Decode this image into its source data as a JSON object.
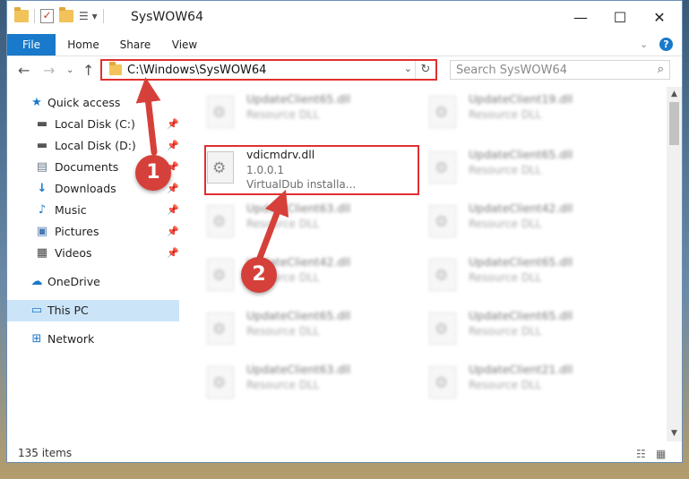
{
  "window": {
    "title": "SysWOW64",
    "controls": {
      "minimize": "—",
      "maximize": "☐",
      "close": "✕"
    }
  },
  "ribbon": {
    "tabs": [
      "File",
      "Home",
      "Share",
      "View"
    ],
    "help": "?"
  },
  "address": {
    "path": "C:\\Windows\\SysWOW64",
    "search_placeholder": "Search SysWOW64"
  },
  "sidebar": {
    "items": [
      {
        "label": "Quick access",
        "icon": "star-icon",
        "pinned": false
      },
      {
        "label": "Local Disk (C:)",
        "icon": "drive-icon",
        "pinned": true
      },
      {
        "label": "Local Disk (D:)",
        "icon": "drive-icon",
        "pinned": true
      },
      {
        "label": "Documents",
        "icon": "documents-icon",
        "pinned": true
      },
      {
        "label": "Downloads",
        "icon": "download-icon",
        "pinned": true
      },
      {
        "label": "Music",
        "icon": "music-icon",
        "pinned": true
      },
      {
        "label": "Pictures",
        "icon": "pictures-icon",
        "pinned": true
      },
      {
        "label": "Videos",
        "icon": "videos-icon",
        "pinned": true
      },
      {
        "label": "OneDrive",
        "icon": "cloud-icon",
        "pinned": false
      },
      {
        "label": "This PC",
        "icon": "computer-icon",
        "pinned": false,
        "selected": true
      },
      {
        "label": "Network",
        "icon": "network-icon",
        "pinned": false
      }
    ]
  },
  "files": {
    "left_column": [
      {
        "name": "UpdateClient65.dll",
        "type": "Resource DLL"
      },
      {
        "name": "vdicmdrv.dll",
        "version": "1.0.0.1",
        "description": "VirtualDub installa..."
      },
      {
        "name": "UpdateClient63.dll",
        "type": "Resource DLL"
      },
      {
        "name": "UpdateClient42.dll",
        "type": "Resource DLL"
      },
      {
        "name": "UpdateClient65.dll",
        "type": "Resource DLL"
      },
      {
        "name": "UpdateClient63.dll",
        "type": "Resource DLL"
      }
    ],
    "right_column": [
      {
        "name": "UpdateClient19.dll",
        "type": "Resource DLL"
      },
      {
        "name": "UpdateClient65.dll",
        "type": "Resource DLL"
      },
      {
        "name": "UpdateClient42.dll",
        "type": "Resource DLL"
      },
      {
        "name": "UpdateClient65.dll",
        "type": "Resource DLL"
      },
      {
        "name": "UpdateClient65.dll",
        "type": "Resource DLL"
      },
      {
        "name": "UpdateClient21.dll",
        "type": "Resource DLL"
      }
    ]
  },
  "status": {
    "item_count": "135 items"
  },
  "annotations": {
    "step1": "1",
    "step2": "2",
    "color": "#d6403a"
  }
}
